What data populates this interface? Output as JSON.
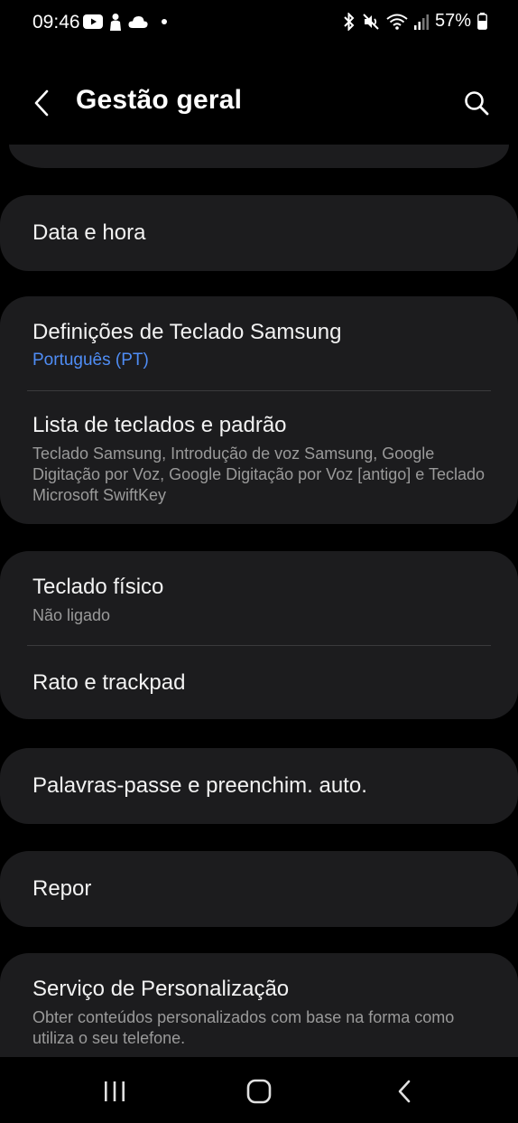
{
  "status": {
    "time": "09:46",
    "battery": "57%",
    "left_icons": [
      "youtube-icon",
      "person-icon",
      "cloud-icon",
      "dot-icon"
    ],
    "right_icons": [
      "bluetooth-icon",
      "mute-icon",
      "wifi-icon",
      "signal-icon",
      "battery-icon"
    ]
  },
  "header": {
    "title": "Gestão geral"
  },
  "items": {
    "date_time": {
      "title": "Data e hora"
    },
    "samsung_keyboard": {
      "title": "Definições de Teclado Samsung",
      "subtitle": "Português (PT)"
    },
    "keyboard_list": {
      "title": "Lista de teclados e padrão",
      "subtitle": "Teclado Samsung, Introdução de voz Samsung, Google Digitação por Voz, Google Digitação por Voz [antigo] e Teclado Microsoft SwiftKey"
    },
    "physical_keyboard": {
      "title": "Teclado físico",
      "subtitle": "Não ligado"
    },
    "mouse_trackpad": {
      "title": "Rato e trackpad"
    },
    "passwords_autofill": {
      "title": "Palavras-passe e preenchim. auto."
    },
    "reset": {
      "title": "Repor"
    },
    "personalization": {
      "title": "Serviço de Personalização",
      "subtitle": "Obter conteúdos personalizados com base na forma como utiliza o seu telefone."
    }
  },
  "colors": {
    "background": "#000000",
    "card": "#1c1c1e",
    "accent": "#4f8df5",
    "secondary_text": "#9a9a9a"
  }
}
